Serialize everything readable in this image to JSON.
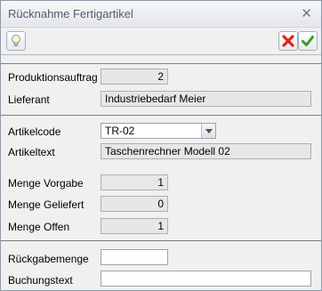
{
  "window": {
    "title": "Rücknahme Fertigartikel",
    "close_glyph": "✕"
  },
  "toolbar": {
    "tip_icon": "lightbulb-icon",
    "cancel_icon": "red-x-icon",
    "ok_icon": "green-check-icon",
    "colors": {
      "cancel": "#d9261c",
      "ok": "#3c9a1f",
      "bulb": "#f2d542"
    }
  },
  "form": {
    "produktionsauftrag": {
      "label": "Produktionsauftrag",
      "value": "2"
    },
    "lieferant": {
      "label": "Lieferant",
      "value": "Industriebedarf Meier"
    },
    "artikelcode": {
      "label": "Artikelcode",
      "value": "TR-02"
    },
    "artikeltext": {
      "label": "Artikeltext",
      "value": "Taschenrechner Modell 02"
    },
    "menge_vorgabe": {
      "label": "Menge Vorgabe",
      "value": "1"
    },
    "menge_geliefert": {
      "label": "Menge Geliefert",
      "value": "0"
    },
    "menge_offen": {
      "label": "Menge Offen",
      "value": "1"
    },
    "rueckgabemenge": {
      "label": "Rückgabemenge",
      "value": ""
    },
    "buchungstext": {
      "label": "Buchungstext",
      "value": ""
    }
  }
}
